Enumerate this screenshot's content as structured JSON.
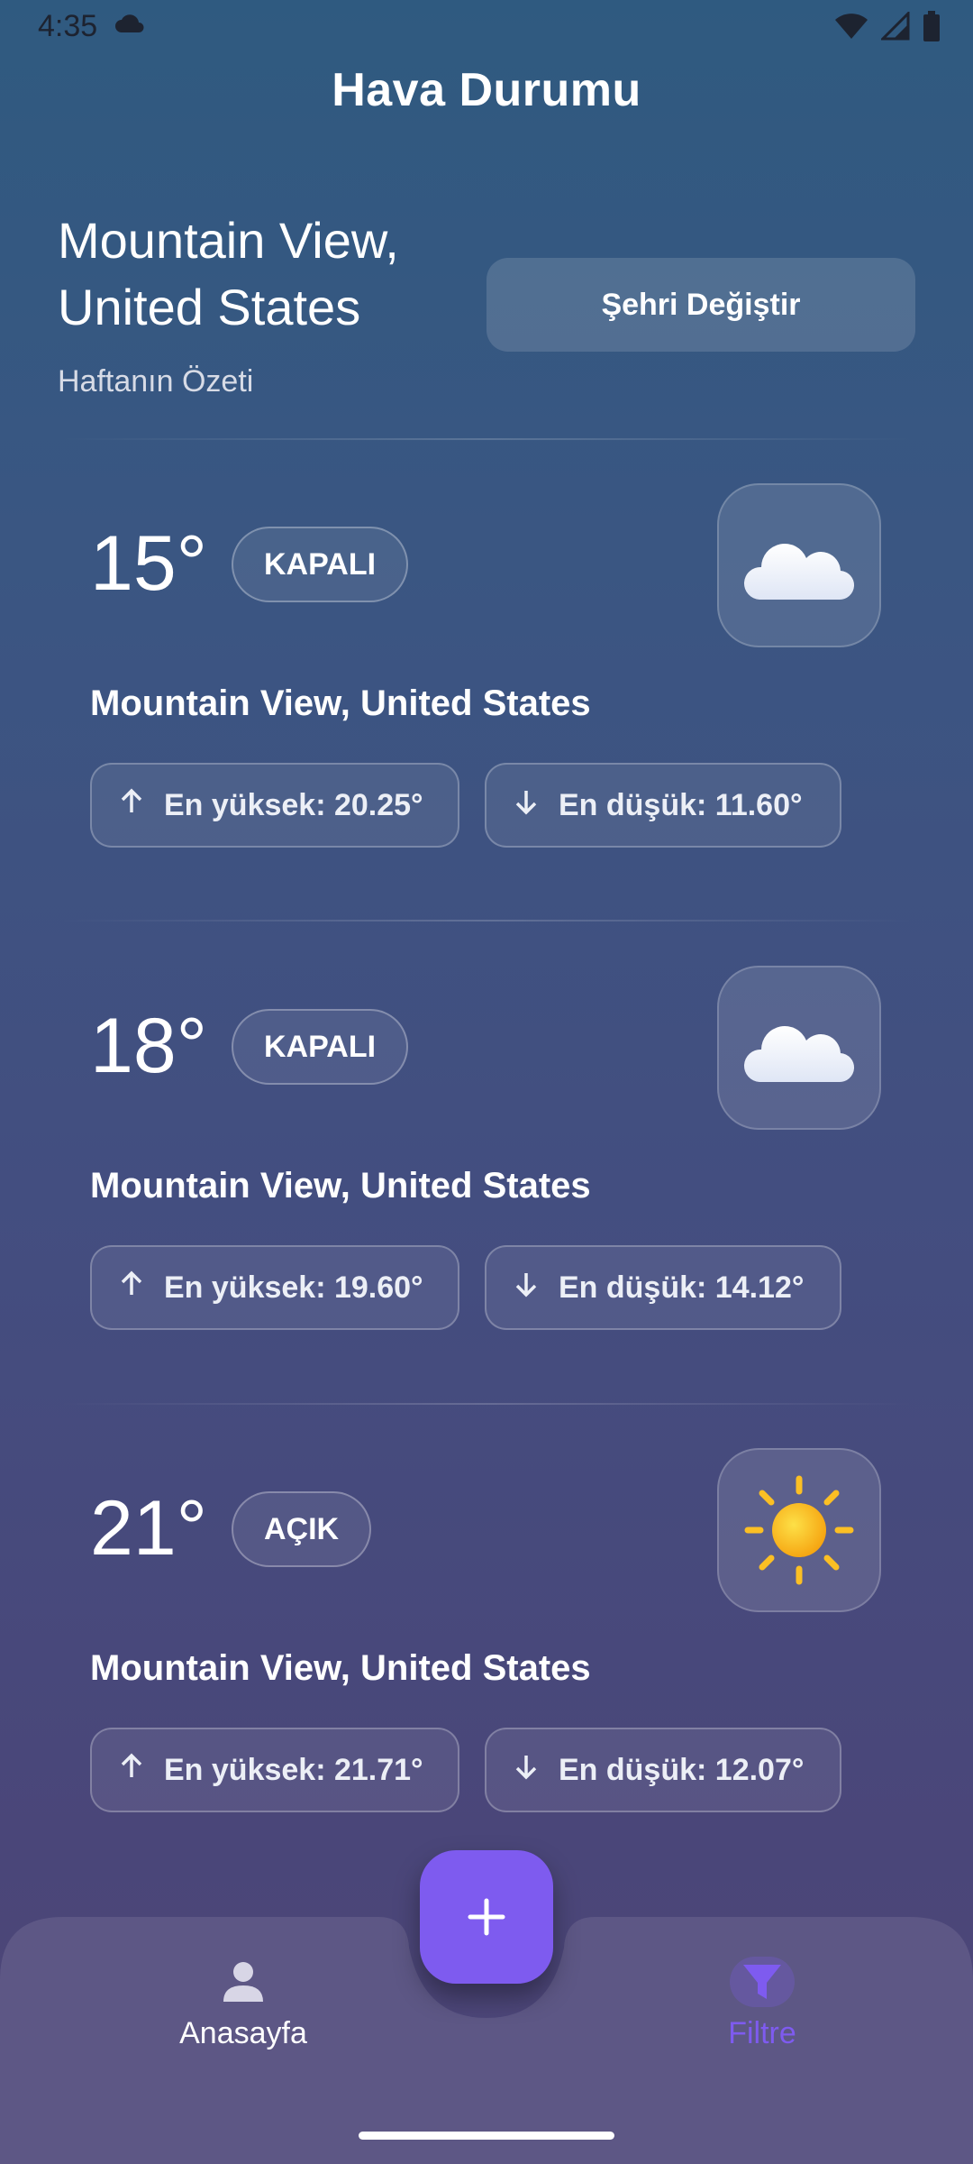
{
  "status_bar": {
    "time": "4:35"
  },
  "header": {
    "title": "Hava Durumu"
  },
  "location": {
    "city": "Mountain View, United States",
    "subtitle": "Haftanın Özeti",
    "change_button": "Şehri Değiştir"
  },
  "forecasts": [
    {
      "temp": "15°",
      "condition": "KAPALI",
      "icon": "cloud-icon",
      "city": "Mountain View, United States",
      "high": "En yüksek: 20.25°",
      "low": "En düşük: 11.60°"
    },
    {
      "temp": "18°",
      "condition": "KAPALI",
      "icon": "cloud-icon",
      "city": "Mountain View, United States",
      "high": "En yüksek: 19.60°",
      "low": "En düşük: 14.12°"
    },
    {
      "temp": "21°",
      "condition": "AÇIK",
      "icon": "sun-icon",
      "city": "Mountain View, United States",
      "high": "En yüksek: 21.71°",
      "low": "En düşük: 12.07°"
    }
  ],
  "nav": {
    "home_label": "Anasayfa",
    "filter_label": "Filtre",
    "fab_icon": "plus-icon"
  },
  "colors": {
    "accent": "#7e5bef",
    "sun": "#fbbf24"
  }
}
